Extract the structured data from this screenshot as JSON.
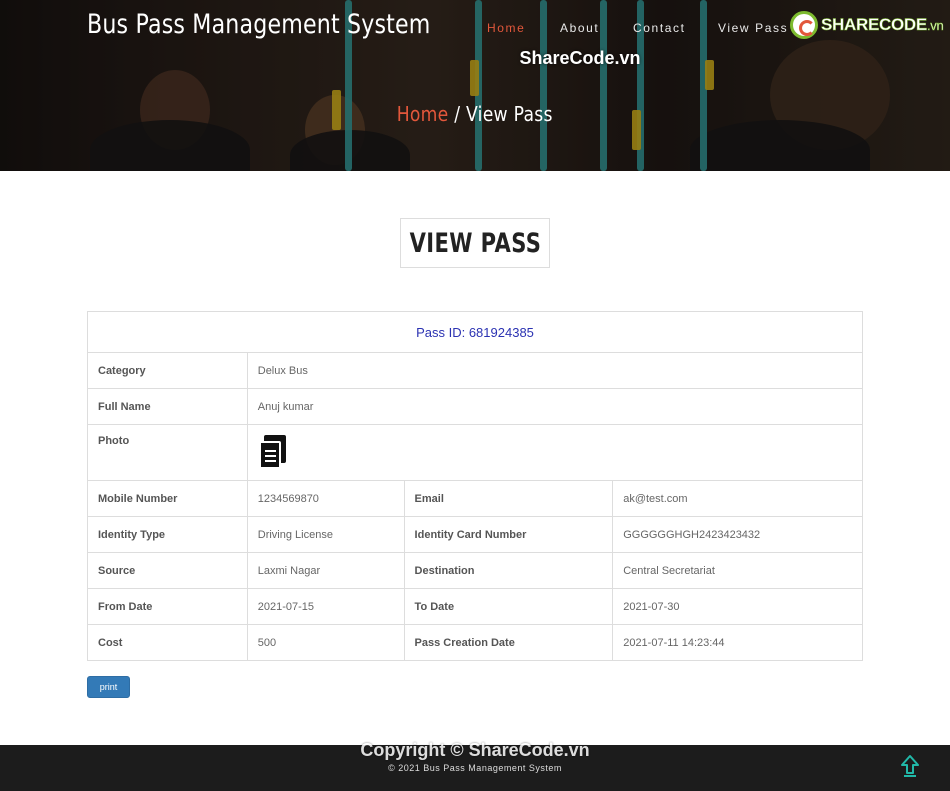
{
  "header": {
    "brand": "Bus Pass Management System",
    "nav": [
      "Home",
      "About",
      "Contact",
      "View Pass"
    ],
    "active_nav": "Home",
    "logo_text": "SHARECODE",
    "logo_suffix": ".vn",
    "watermark": "ShareCode.vn",
    "breadcrumb": {
      "home": "Home",
      "separator": " / ",
      "current": "View Pass"
    }
  },
  "page_title": "VIEW PASS",
  "pass": {
    "id_label": "Pass ID: 681924385",
    "category_label": "Category",
    "category": "Delux Bus",
    "fullname_label": "Full Name",
    "fullname": "Anuj kumar",
    "photo_label": "Photo",
    "mobile_label": "Mobile Number",
    "mobile": "1234569870",
    "email_label": "Email",
    "email": "ak@test.com",
    "idtype_label": "Identity Type",
    "idtype": "Driving License",
    "idnum_label": "Identity Card Number",
    "idnum": "GGGGGGHGH2423423432",
    "source_label": "Source",
    "source": "Laxmi Nagar",
    "dest_label": "Destination",
    "dest": "Central Secretariat",
    "from_label": "From Date",
    "from": "2021-07-15",
    "to_label": "To Date",
    "to": "2021-07-30",
    "cost_label": "Cost",
    "cost": "500",
    "created_label": "Pass Creation Date",
    "created": "2021-07-11 14:23:44"
  },
  "print_label": "print",
  "footer": {
    "watermark": "Copyright © ShareCode.vn",
    "copyright": "© 2021 Bus Pass Management System"
  },
  "colors": {
    "accent": "#e2573b",
    "pass_id": "#2b32b2",
    "button": "#337ab7",
    "footer_bg": "#1c1c1c"
  },
  "icons": [
    "document-icon",
    "arrow-up-icon",
    "sharecode-logo"
  ]
}
